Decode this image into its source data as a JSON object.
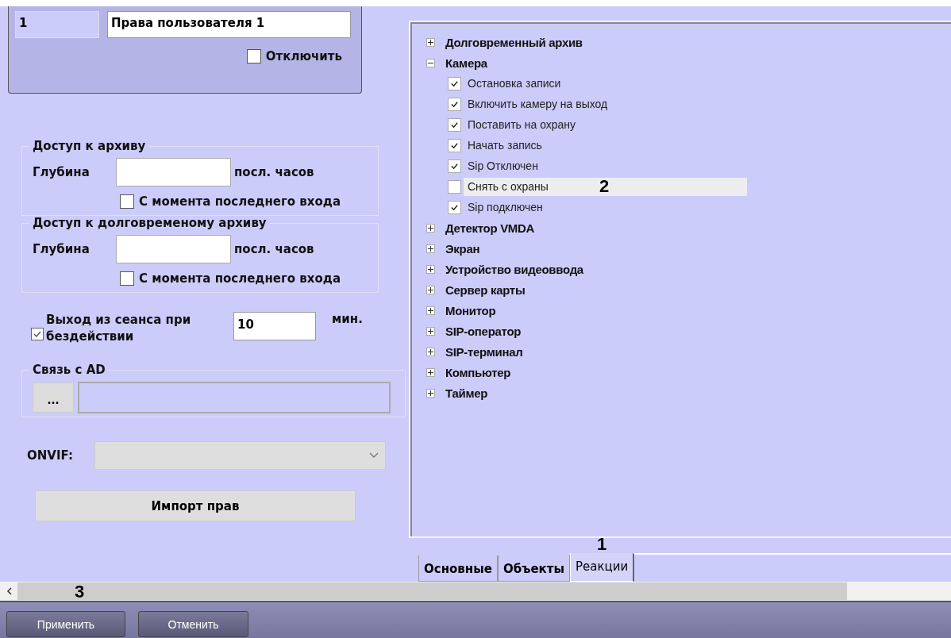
{
  "header": {
    "id_value": "1",
    "name_value": "Права пользователя 1",
    "disable": {
      "label": "Отключить",
      "checked": false
    }
  },
  "archive_sections": [
    {
      "title": "Доступ к архиву",
      "depth_label": "Глубина",
      "unit": "посл. часов",
      "since_last": {
        "label": "С момента последнего входа",
        "checked": false
      }
    },
    {
      "title": "Доступ к долговременому архиву",
      "depth_label": "Глубина",
      "unit": "посл. часов",
      "since_last": {
        "label": "С момента последнего входа",
        "checked": false
      }
    }
  ],
  "session_timeout": {
    "label": "Выход из сеанса при бездействии",
    "checked": true,
    "value": "10",
    "unit": "мин."
  },
  "ad_link": {
    "title": "Связь с AD",
    "browse_button": "..."
  },
  "onvif": {
    "label": "ONVIF:"
  },
  "import_button": "Импорт прав",
  "tree": [
    {
      "label": "Долговременный архив",
      "expanded": false
    },
    {
      "label": "Камера",
      "expanded": true,
      "children": [
        {
          "label": "Остановка записи",
          "checked": true,
          "selected": false
        },
        {
          "label": "Включить камеру на выход",
          "checked": true,
          "selected": false
        },
        {
          "label": "Поставить на охрану",
          "checked": true,
          "selected": false
        },
        {
          "label": "Начать запись",
          "checked": true,
          "selected": false
        },
        {
          "label": "Sip Отключен",
          "checked": true,
          "selected": false
        },
        {
          "label": "Снять с охраны",
          "checked": false,
          "selected": true,
          "callout": "2"
        },
        {
          "label": "Sip подключен",
          "checked": true,
          "selected": false
        }
      ]
    },
    {
      "label": "Детектор VMDA",
      "expanded": false
    },
    {
      "label": "Экран",
      "expanded": false
    },
    {
      "label": "Устройство видеоввода",
      "expanded": false
    },
    {
      "label": "Сервер карты",
      "expanded": false
    },
    {
      "label": "Монитор",
      "expanded": false
    },
    {
      "label": "SIP-оператор",
      "expanded": false
    },
    {
      "label": "SIP-терминал",
      "expanded": false
    },
    {
      "label": "Компьютер",
      "expanded": false
    },
    {
      "label": "Таймер",
      "expanded": false
    }
  ],
  "tabs": [
    {
      "label": "Основные",
      "selected": false
    },
    {
      "label": "Объекты",
      "selected": false
    },
    {
      "label": "Реакции",
      "selected": true,
      "callout": "1"
    }
  ],
  "scrollbar_callout": "3",
  "buttons": [
    "Применить",
    "Отменить"
  ]
}
